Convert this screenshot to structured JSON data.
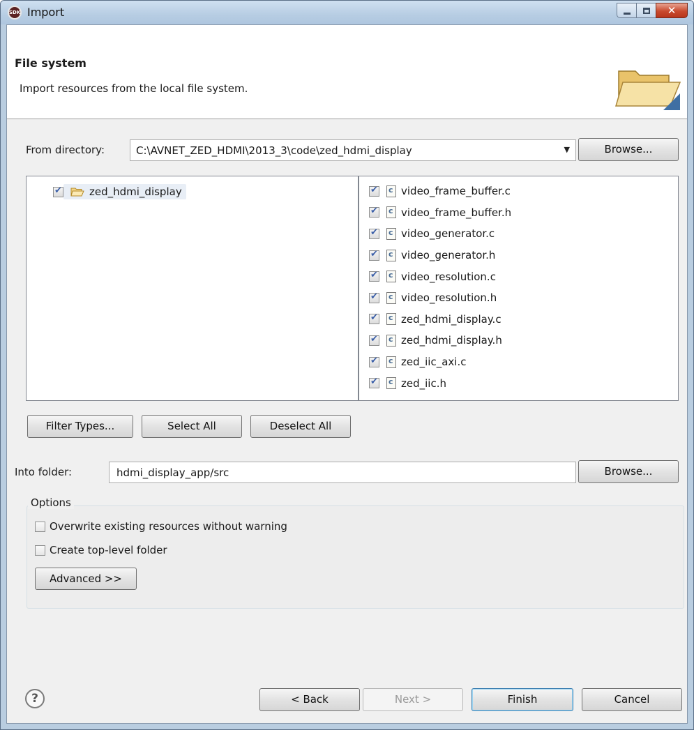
{
  "window": {
    "title": "Import",
    "app_icon_text": "SDK"
  },
  "banner": {
    "title": "File system",
    "description": "Import resources from the local file system."
  },
  "from_directory": {
    "label": "From directory:",
    "value": "C:\\AVNET_ZED_HDMI\\2013_3\\code\\zed_hdmi_display",
    "browse_label": "Browse..."
  },
  "tree": {
    "items": [
      {
        "label": "zed_hdmi_display",
        "checked": true
      }
    ]
  },
  "files": [
    {
      "name": "video_frame_buffer.c",
      "checked": true
    },
    {
      "name": "video_frame_buffer.h",
      "checked": true
    },
    {
      "name": "video_generator.c",
      "checked": true
    },
    {
      "name": "video_generator.h",
      "checked": true
    },
    {
      "name": "video_resolution.c",
      "checked": true
    },
    {
      "name": "video_resolution.h",
      "checked": true
    },
    {
      "name": "zed_hdmi_display.c",
      "checked": true
    },
    {
      "name": "zed_hdmi_display.h",
      "checked": true
    },
    {
      "name": "zed_iic_axi.c",
      "checked": true
    },
    {
      "name": "zed_iic.h",
      "checked": true
    }
  ],
  "selection_buttons": {
    "filter_types": "Filter Types...",
    "select_all": "Select All",
    "deselect_all": "Deselect All"
  },
  "into_folder": {
    "label": "Into folder:",
    "value": "hdmi_display_app/src",
    "browse_label": "Browse..."
  },
  "options": {
    "title": "Options",
    "overwrite_label": "Overwrite existing resources without warning",
    "overwrite_checked": false,
    "create_top_level_label": "Create top-level folder",
    "create_top_level_checked": false,
    "advanced_label": "Advanced >>"
  },
  "footer": {
    "help_icon": "?",
    "back_label": "< Back",
    "next_label": "Next >",
    "finish_label": "Finish",
    "cancel_label": "Cancel"
  },
  "colors": {
    "title_bar": "#b7cde3",
    "close_button": "#c94a2e",
    "dialog_bg": "#f0f0f0",
    "default_button_border": "#3c7fb1"
  }
}
